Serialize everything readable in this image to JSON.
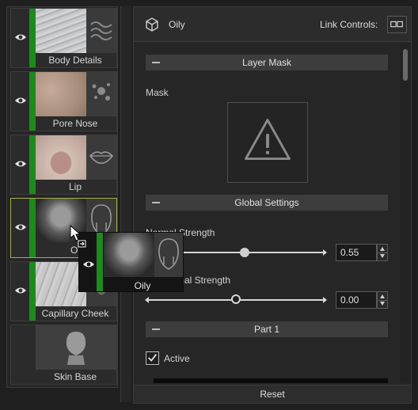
{
  "layers": [
    {
      "name": "Body Details",
      "thumb": "body-details-texture",
      "badge_icon": "detail-layers-icon"
    },
    {
      "name": "Pore Nose",
      "thumb": "pore-nose-texture",
      "badge_icon": "pores-icon"
    },
    {
      "name": "Lip",
      "thumb": "lip-texture",
      "badge_icon": "lips-icon"
    },
    {
      "name": "Oi",
      "thumb": "oily-face-texture",
      "badge_icon": "head-mask-icon",
      "selected": true
    },
    {
      "name": "Capillary Cheek",
      "thumb": "capillary-cheek-texture",
      "badge_icon": "head-icon"
    },
    {
      "name": "Skin Base",
      "thumb": "head-silhouette",
      "badge_icon": ""
    }
  ],
  "drag_ghost": {
    "name": "Oily"
  },
  "header": {
    "title": "Oily",
    "link_controls_label": "Link Controls:"
  },
  "sections": {
    "layer_mask": {
      "title": "Layer Mask",
      "mask_label": "Mask"
    },
    "global_settings": {
      "title": "Global Settings",
      "normal_strength": {
        "label": "Normal Strength",
        "value": "0.55",
        "fraction": 0.55
      },
      "second_strength": {
        "label": "rmal Strength",
        "value": "0.00",
        "fraction": 0.0
      }
    },
    "part1": {
      "title": "Part 1",
      "active_label": "Active",
      "active_checked": true
    }
  },
  "footer": {
    "reset_label": "Reset"
  },
  "colors": {
    "accent_green": "#1d8a1d",
    "selected_border": "#a7b04a",
    "panel_bg": "#262626",
    "section_bg": "#3d3d3d"
  }
}
